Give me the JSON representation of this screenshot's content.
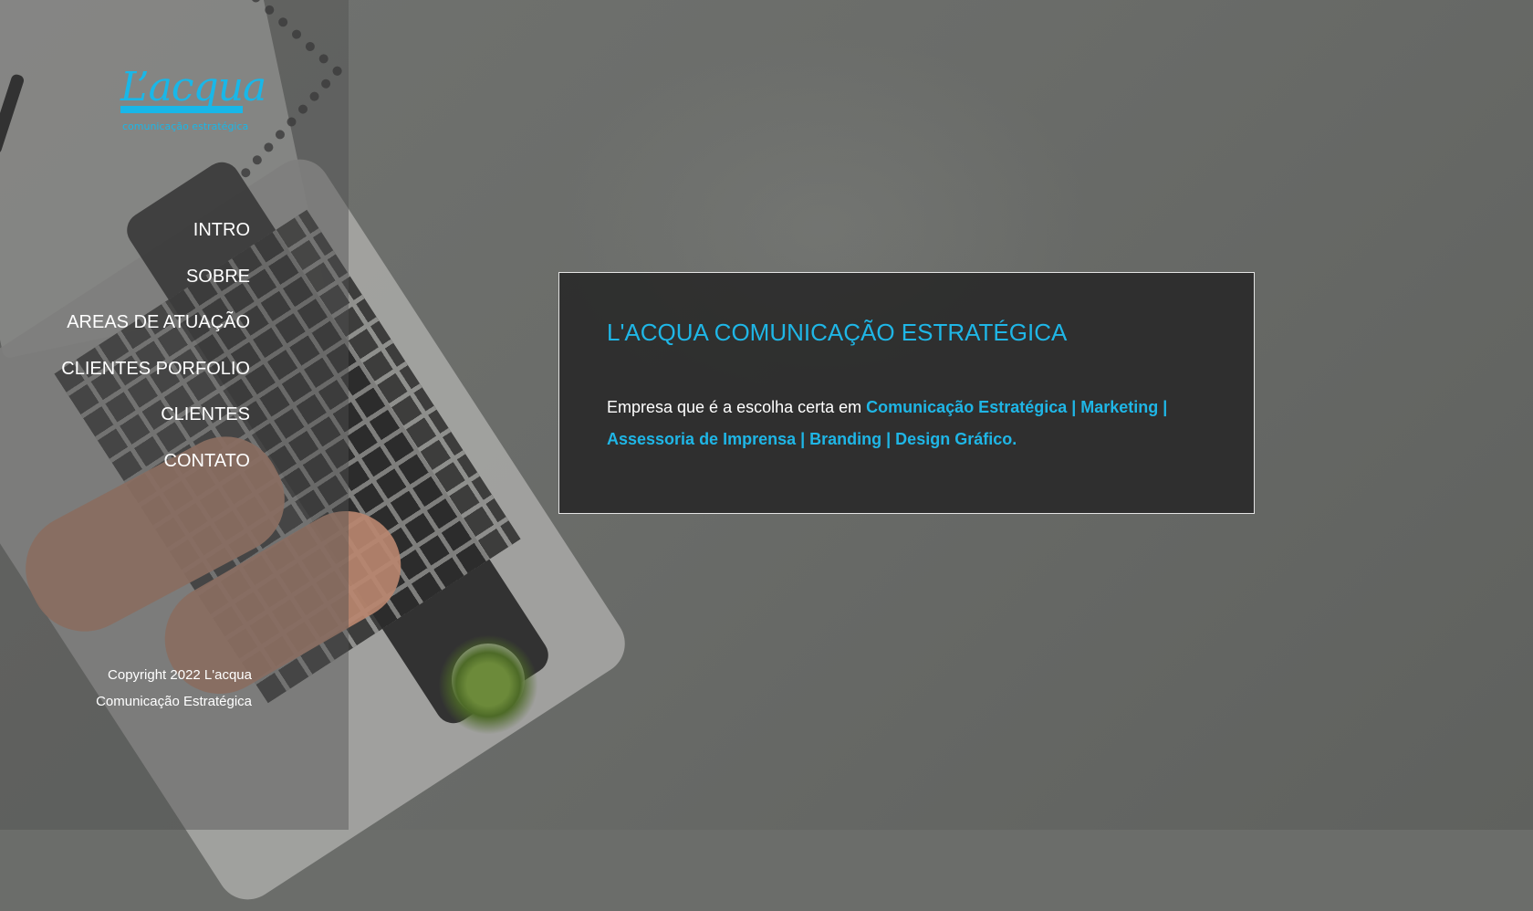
{
  "brand": {
    "logo_word": "L’acqua",
    "logo_subtitle": "comunicação estratégica",
    "accent_color": "#1fb6e6"
  },
  "nav": {
    "items": [
      {
        "label": "INTRO"
      },
      {
        "label": "SOBRE"
      },
      {
        "label": "AREAS DE ATUAÇÃO"
      },
      {
        "label": "CLIENTES PORFOLIO"
      },
      {
        "label": "CLIENTES"
      },
      {
        "label": "CONTATO"
      }
    ]
  },
  "footer": {
    "copyright_line1": "Copyright 2022 L'acqua",
    "copyright_line2": "Comunicação Estratégica"
  },
  "intro": {
    "title": "L'ACQUA COMUNICAÇÃO ESTRATÉGICA",
    "text_prefix": "Empresa que é a escolha certa em ",
    "text_highlight": "Comunicação Estratégica | Marketing | Assessoria de Imprensa | Branding | Design Gráfico."
  }
}
